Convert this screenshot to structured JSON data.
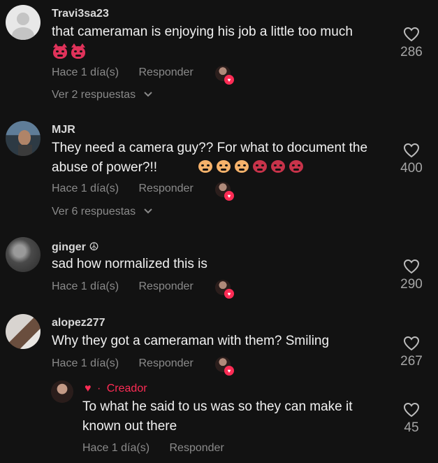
{
  "comments": [
    {
      "username": "Travi3sa23",
      "text": "that cameraman is enjoying his job a little too much",
      "emojis": [
        "devil-emoji",
        "devil-emoji"
      ],
      "time": "Hace 1 día(s)",
      "reply": "Responder",
      "likes": "286",
      "view_replies": "Ver 2 respuestas"
    },
    {
      "username": "MJR",
      "text": "They need a camera guy?? For what to document the abuse of power?!!",
      "emojis": [
        "wail-emoji",
        "wail-emoji",
        "wail-emoji",
        "angry-emoji",
        "angry-emoji",
        "angry-emoji"
      ],
      "time": "Hace 1 día(s)",
      "reply": "Responder",
      "likes": "400",
      "view_replies": "Ver 6 respuestas"
    },
    {
      "username": "ginger ☮",
      "text": "sad how normalized this is",
      "time": "Hace 1 día(s)",
      "reply": "Responder",
      "likes": "290"
    },
    {
      "username": "alopez277",
      "text": "Why they got a cameraman with them? Smiling",
      "time": "Hace 1 día(s)",
      "reply": "Responder",
      "likes": "267"
    }
  ],
  "creator_reply": {
    "heart": "♥",
    "separator": "·",
    "label": "Creador",
    "text": "To what he said to us was so they can make it known out there",
    "time": "Hace 1 día(s)",
    "reply": "Responder",
    "likes": "45"
  },
  "colors": {
    "background": "#121212",
    "accent": "#fe2c55",
    "muted": "#8a8a8a"
  }
}
